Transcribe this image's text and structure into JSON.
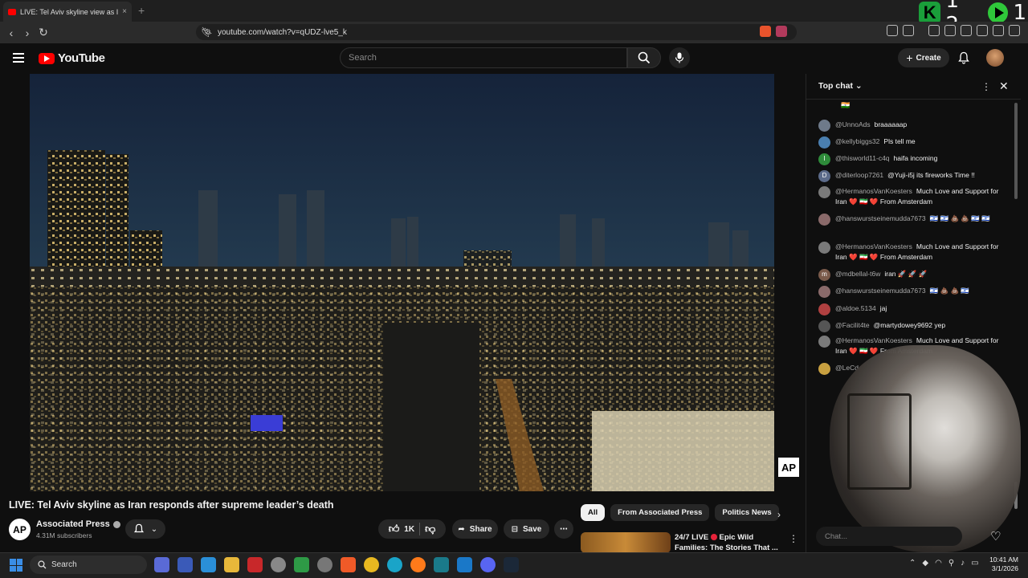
{
  "browser": {
    "tab_title": "LIVE: Tel Aviv skyline view as I",
    "tab_close": "×",
    "new_tab": "+",
    "url": "youtube.com/watch?v=qUDZ-lve5_k",
    "overlay_left": "1 2",
    "overlay_right": "1"
  },
  "header": {
    "logo_text": "YouTube",
    "search_placeholder": "Search",
    "create_label": "Create"
  },
  "video": {
    "title": "LIVE: Tel Aviv skyline as Iran responds after supreme leader’s death",
    "watermark": "AP",
    "channel_avatar": "AP",
    "channel_name": "Associated Press",
    "subscribers": "4.31M subscribers",
    "like_count": "1K",
    "share_label": "Share",
    "save_label": "Save"
  },
  "chips": [
    "All",
    "From Associated Press",
    "Politics News"
  ],
  "recommendation": {
    "title_line1": "24/7 LIVE",
    "title_rest": "Epic Wild Families: The Stories That ..."
  },
  "chat": {
    "title": "Top chat",
    "input_placeholder": "Chat...",
    "messages": [
      {
        "author": "@UnnoAds",
        "text": "braaaaaap",
        "avatar": "",
        "color": "#6e7a8a"
      },
      {
        "author": "@kellybiggs32",
        "text": "Pls tell me",
        "avatar": "",
        "color": "#4a7fb0"
      },
      {
        "author": "@thisworld11-c4q",
        "text": "haifa incoming",
        "avatar": "I",
        "color": "#2e8b3a"
      },
      {
        "author": "@diterloop7261",
        "text": "@Yuji-i5j its fireworks Time !!",
        "avatar": "D",
        "color": "#5c6b8a"
      },
      {
        "author": "@HermanosVanKoesters",
        "text": "Much Love and Support for Iran ❤️ 🇮🇷 ❤️ From Amsterdam",
        "avatar": "",
        "color": "#7a7a7a"
      },
      {
        "author": "@hanswurstseinemudda7673",
        "text": "🇮🇱 🇮🇱 💩 💩 🇮🇱 🇮🇱",
        "avatar": "",
        "color": "#8a6a6a"
      },
      {
        "author": "@HermanosVanKoesters",
        "text": "Much Love and Support for Iran ❤️ 🇮🇷 ❤️ From Amsterdam",
        "avatar": "",
        "color": "#7a7a7a"
      },
      {
        "author": "@mdbellal-t6w",
        "text": "iran 🚀 🚀 🚀",
        "avatar": "m",
        "color": "#7a5a4a"
      },
      {
        "author": "@hanswurstseinemudda7673",
        "text": "🇮🇱 💩 💩 🇮🇱",
        "avatar": "",
        "color": "#8a6a6a"
      },
      {
        "author": "@aldoe.5134",
        "text": "jaj",
        "avatar": "",
        "color": "#b04040"
      },
      {
        "author": "@Facilit4te",
        "text": "@martydowey9692 yep",
        "avatar": "",
        "color": "#555"
      },
      {
        "author": "@HermanosVanKoesters",
        "text": "Much Love and Support for Iran ❤️ 🇮🇷 ❤️ From Amsterdam",
        "avatar": "",
        "color": "#7a7a7a"
      },
      {
        "author": "@LeCd",
        "text": "",
        "avatar": "",
        "color": "#c8a040"
      }
    ]
  },
  "taskbar": {
    "search_label": "Search",
    "time": "10:41 AM",
    "date": "3/1/2026"
  }
}
